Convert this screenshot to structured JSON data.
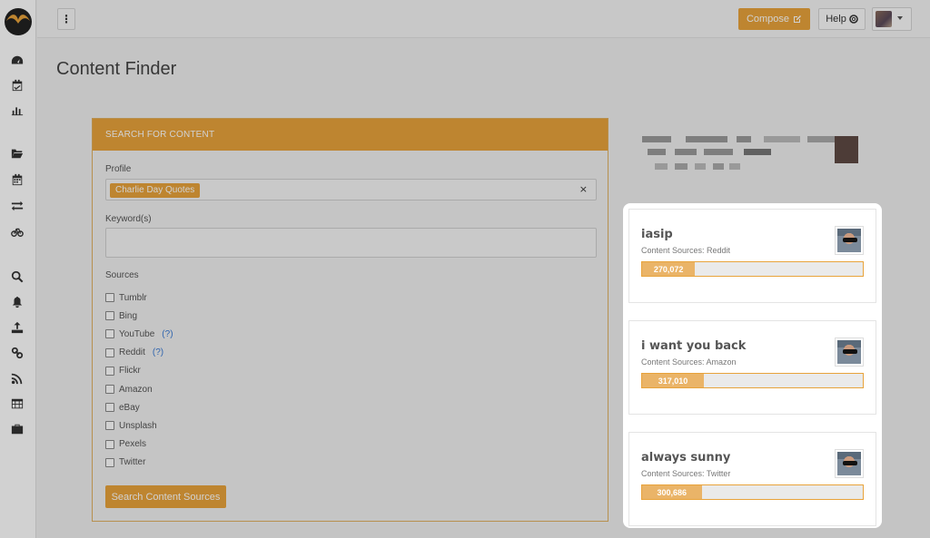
{
  "topbar": {
    "menu_label": "⋮",
    "compose_label": "Compose",
    "help_label": "Help"
  },
  "page": {
    "title": "Content Finder"
  },
  "search": {
    "header": "SEARCH FOR CONTENT",
    "profile_label": "Profile",
    "profile_value": "Charlie Day Quotes",
    "profile_clear": "×",
    "keyword_label": "Keyword(s)",
    "keyword_value": "",
    "sources_label": "Sources",
    "sources": [
      {
        "label": "Tumblr",
        "help": ""
      },
      {
        "label": "Bing",
        "help": ""
      },
      {
        "label": "YouTube",
        "help": "(?)"
      },
      {
        "label": "Reddit",
        "help": "(?)"
      },
      {
        "label": "Flickr",
        "help": ""
      },
      {
        "label": "Amazon",
        "help": ""
      },
      {
        "label": "eBay",
        "help": ""
      },
      {
        "label": "Unsplash",
        "help": ""
      },
      {
        "label": "Pexels",
        "help": ""
      },
      {
        "label": "Twitter",
        "help": ""
      }
    ],
    "button_label": "Search Content Sources"
  },
  "results": [
    {
      "title": "iasip",
      "sources": "Content Sources: Reddit",
      "count": "270,072",
      "fill_fraction": 0.24
    },
    {
      "title": "i want you back",
      "sources": "Content Sources: Amazon",
      "count": "317,010",
      "fill_fraction": 0.28
    },
    {
      "title": "always sunny",
      "sources": "Content Sources: Twitter",
      "count": "300,686",
      "fill_fraction": 0.27
    }
  ],
  "colors": {
    "accent": "#e8a33b",
    "bar_fill": "#eab468",
    "link": "#3a7bd5"
  },
  "icons": {
    "logo": "brand-logo-icon",
    "sidebar": [
      "dashboard-icon",
      "calendar-check-icon",
      "bar-chart-icon",
      "folder-open-icon",
      "calendar-icon",
      "exchange-icon",
      "bicycle-icon",
      "search-icon",
      "bell-icon",
      "upload-icon",
      "link-icon",
      "rss-icon",
      "table-icon",
      "briefcase-icon"
    ]
  }
}
